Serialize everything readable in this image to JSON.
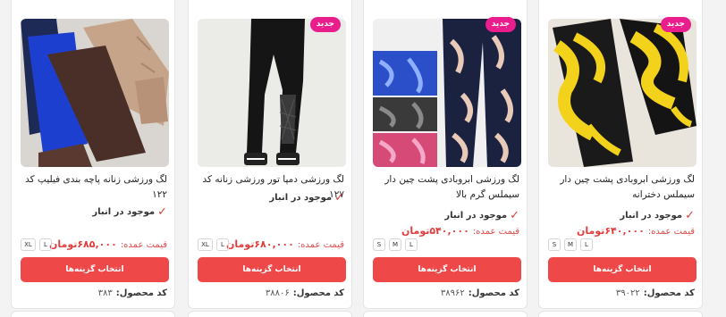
{
  "products": [
    {
      "badge": "جدید",
      "title": "لگ ورزشی ابروبادی پشت چین دار سیملس دخترانه",
      "stock": "موجود در انبار",
      "price_label": "قیمت عمده:",
      "price": "۶۴۰,۰۰۰تومان",
      "sizes": [
        "S",
        "M",
        "L"
      ],
      "button": "انتخاب گزینه‌ها",
      "code_label": "کد محصول:",
      "code": "۳۹۰۲۲"
    },
    {
      "badge": "جدید",
      "title": "لگ ورزشی ابروبادی پشت چین دار سیملس گرم بالا",
      "stock": "موجود در انبار",
      "price_label": "قیمت عمده:",
      "price": "۵۴۰,۰۰۰تومان",
      "sizes": [
        "S",
        "M",
        "L"
      ],
      "button": "انتخاب گزینه‌ها",
      "code_label": "کد محصول:",
      "code": "۳۸۹۶۲"
    },
    {
      "badge": "جدید",
      "title": "لگ ورزشی دمپا تور ورزشی زنانه کد ۱۲۷",
      "stock": "موجود در انبار",
      "price_label": "قیمت عمده:",
      "price": "۶۸۰,۰۰۰تومان",
      "sizes": [
        "XL",
        "L"
      ],
      "button": "انتخاب گزینه‌ها",
      "code_label": "کد محصول:",
      "code": "۳۸۸۰۶"
    },
    {
      "badge": "",
      "title": "لگ ورزشی زنانه پاچه بندی فیلیپ کد ۱۲۲",
      "stock": "موجود در انبار",
      "price_label": "قیمت عمده:",
      "price": "۶۸۵,۰۰۰تومان",
      "sizes": [
        "XL",
        "L"
      ],
      "button": "انتخاب گزینه‌ها",
      "code_label": "کد محصول:",
      "code": "۳۸۳"
    }
  ],
  "colors": {
    "accent": "#ee4848",
    "price": "#e03d3d",
    "badge": "#e91e8c"
  },
  "icons": {
    "stock": "check-icon"
  }
}
